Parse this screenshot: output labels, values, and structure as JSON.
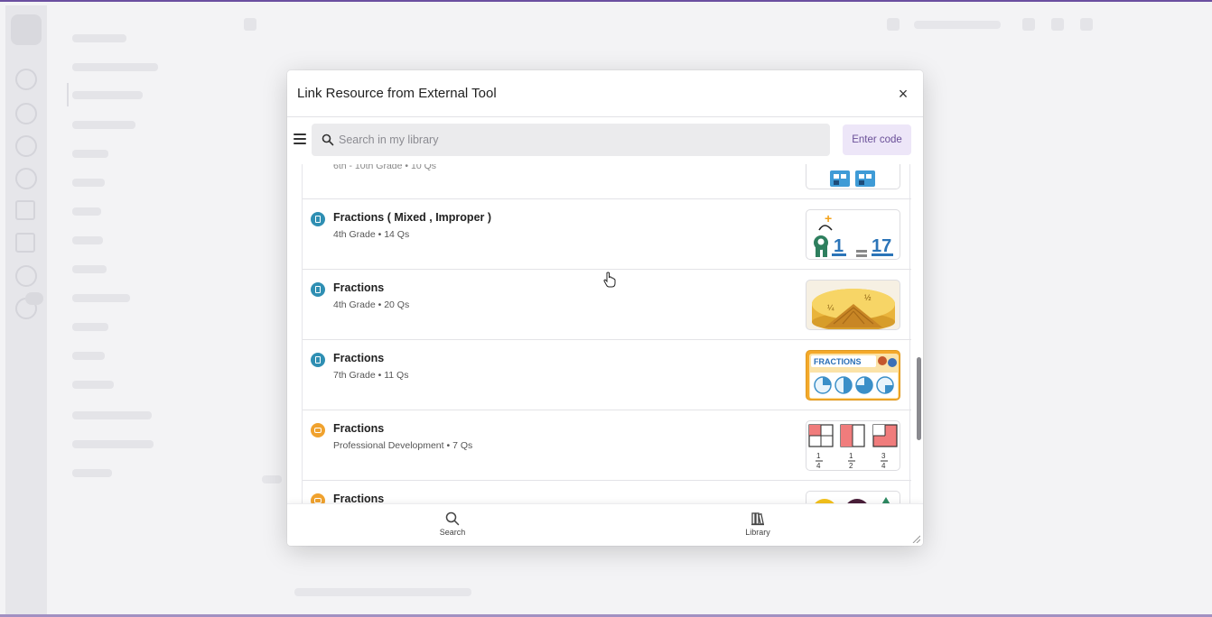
{
  "modal": {
    "title": "Link Resource from External Tool",
    "close_label": "×",
    "search_placeholder": "Search in my library",
    "enter_code_label": "Enter code"
  },
  "list": {
    "partial_top_meta": "6th - 10th Grade • 10 Qs",
    "items": [
      {
        "type": "quiz",
        "icon": "quiz-icon",
        "title": "Fractions ( Mixed , Improper )",
        "meta": "4th Grade • 14 Qs",
        "thumb": "mixed-fraction-thumbnail"
      },
      {
        "type": "quiz",
        "icon": "quiz-icon",
        "title": "Fractions",
        "meta": "4th Grade • 20 Qs",
        "thumb": "pie-fraction-thumbnail"
      },
      {
        "type": "quiz",
        "icon": "quiz-icon",
        "title": "Fractions",
        "meta": "7th Grade • 11 Qs",
        "thumb": "fractions-banner-thumbnail"
      },
      {
        "type": "lesson",
        "icon": "lesson-icon",
        "title": "Fractions",
        "meta": "Professional Development • 7 Qs",
        "thumb": "quarter-squares-thumbnail"
      },
      {
        "type": "lesson",
        "icon": "lesson-icon",
        "title": "Fractions",
        "meta": "",
        "thumb": "shapes-thumbnail"
      }
    ],
    "thumb_text": {
      "mixed_whole": "1",
      "mixed_result": "17",
      "pie_quarter": "¼",
      "pie_half": "½",
      "banner": "FRACTIONS",
      "quarter": "1/4",
      "half": "1/2"
    }
  },
  "bottom_nav": {
    "search_label": "Search",
    "library_label": "Library"
  },
  "colors": {
    "accent": "#6b4fa0",
    "enter_code_bg": "#ede6f8",
    "quiz_icon": "#2f8fb3",
    "lesson_icon": "#f0a22e"
  }
}
